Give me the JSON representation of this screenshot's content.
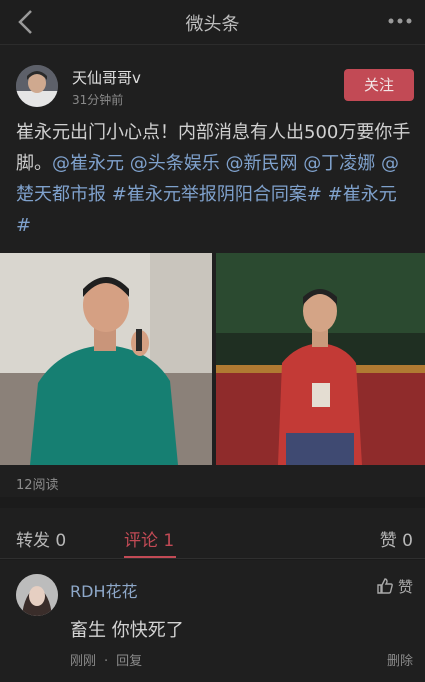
{
  "header": {
    "title": "微头条",
    "back_icon": "back-chevron-icon",
    "more_icon": "more-dots-icon"
  },
  "post": {
    "author": "天仙哥哥v",
    "time": "31分钟前",
    "follow_label": "关注",
    "text_plain": "崔永元出门小心点！内部消息有人出500万要你手脚。",
    "mention_1": "@崔永元",
    "mention_2": "@头条娱乐",
    "mention_3": "@新民网",
    "mention_4": "@丁凌娜",
    "mention_5": "@楚天都市报",
    "tag_1": "#崔永元举报阴阳合同案#",
    "tag_2": "#崔永元#",
    "read_count": "12阅读"
  },
  "tabs": {
    "repost": "转发 0",
    "comments": "评论 1",
    "likes": "赞 0"
  },
  "comment": {
    "name": "RDH花花",
    "like_label": "赞",
    "text": "畜生 你快死了",
    "time": "刚刚",
    "reply_label": "回复",
    "delete_label": "删除"
  },
  "colors": {
    "accent": "#c24a55",
    "link": "#7fa1cc",
    "background": "#1b1b1b"
  }
}
